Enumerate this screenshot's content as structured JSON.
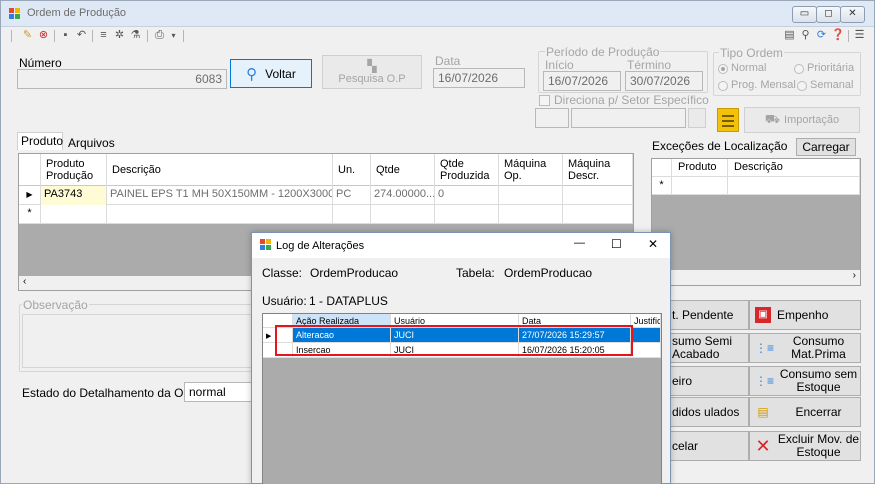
{
  "window": {
    "title": "Ordem de Produção",
    "controls": [
      "▭",
      "◻",
      "✕"
    ]
  },
  "header": {
    "numero_label": "Número",
    "numero_value": "6083",
    "voltar_label": "Voltar",
    "pesquisa_label": "Pesquisa O.P",
    "data_label": "Data",
    "data_value": "16/07/2026",
    "periodo_label": "Período de Produção",
    "inicio_label": "Início",
    "inicio_value": "16/07/2026",
    "termino_label": "Término",
    "termino_value": "30/07/2026",
    "direciona_label": "Direciona p/ Setor Específico",
    "tipo_label": "Tipo Ordem",
    "tipo_options": [
      "Normal",
      "Prioritária",
      "Prog. Mensal",
      "Semanal"
    ],
    "importacao_label": "Importação"
  },
  "tabs": [
    "Produto",
    "Arquivos"
  ],
  "product_grid": {
    "headers": [
      "Produto Produção",
      "Descrição",
      "Un.",
      "Qtde",
      "Qtde Produzida",
      "Máquina Op.",
      "Máquina Descr."
    ],
    "rows": [
      [
        "PA3743",
        "PAINEL EPS T1 MH 50X150MM - 1200X3000...",
        "PC",
        "274.00000...",
        "0",
        "",
        ""
      ]
    ],
    "row_marker": "▶",
    "new_marker": "*"
  },
  "excecoes": {
    "title": "Exceções de Localização",
    "carregar_label": "Carregar",
    "headers": [
      "Produto",
      "Descrição"
    ],
    "new_marker": "*"
  },
  "observacao_label": "Observação",
  "estado": {
    "label": "Estado do Detalhamento da OP:",
    "value": "normal"
  },
  "side_buttons": [
    {
      "label": "t. Pendente"
    },
    {
      "label": "Empenho"
    },
    {
      "label": "sumo Semi Acabado"
    },
    {
      "label": "Consumo Mat.Prima"
    },
    {
      "label": "eiro"
    },
    {
      "label": "Consumo sem Estoque"
    },
    {
      "label": "didos ulados"
    },
    {
      "label": "Encerrar"
    },
    {
      "label": "celar"
    },
    {
      "label": "Excluir Mov. de Estoque"
    }
  ],
  "dialog": {
    "title": "Log de Alterações",
    "classe_label": "Classe:",
    "classe_value": "OrdemProducao",
    "tabela_label": "Tabela:",
    "tabela_value": "OrdemProducao",
    "usuario_label": "Usuário:",
    "usuario_value": "1 - DATAPLUS",
    "headers": [
      "Ação Realizada",
      "Usuário",
      "Data",
      "Justificativa"
    ],
    "rows": [
      [
        "Alteracao",
        "JUCI",
        "27/07/2026 15:29:57",
        ""
      ],
      [
        "Insercao",
        "JUCI",
        "16/07/2026 15:20:05",
        ""
      ]
    ],
    "row_marker": "▶",
    "controls": [
      "—",
      "☐",
      "✕"
    ]
  },
  "colors": {
    "selection": "#0078d7",
    "highlight_border": "#e8141c"
  }
}
